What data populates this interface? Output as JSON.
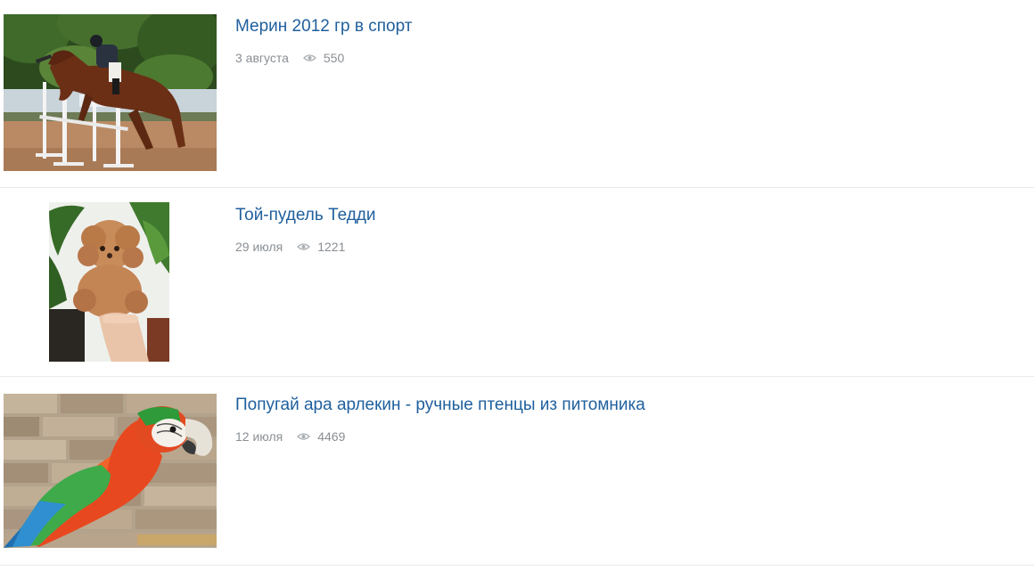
{
  "listing": {
    "items": [
      {
        "title": "Мерин 2012 гр в спорт",
        "date": "3 августа",
        "views": "550",
        "views_icon": "eye-icon",
        "image_subject": "horse jumping"
      },
      {
        "title": "Той-пудель Тедди",
        "date": "29 июля",
        "views": "1221",
        "views_icon": "eye-icon",
        "image_subject": "toy poodle"
      },
      {
        "title": "Попугай ара арлекин - ручные птенцы из питомника",
        "date": "12 июля",
        "views": "4469",
        "views_icon": "eye-icon",
        "image_subject": "harlequin macaw"
      }
    ],
    "colors": {
      "title_link": "#1f5f9d",
      "meta_text": "#8a8f94",
      "divider": "#e6e9ec"
    }
  }
}
